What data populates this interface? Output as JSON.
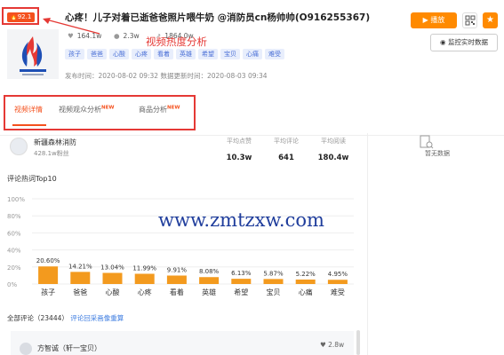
{
  "header": {
    "heat_score": "92.1",
    "title": "心疼！儿子对着已逝爸爸照片喂牛奶 @消防员cn杨帅帅(O916255367)",
    "stats": {
      "likes": "164.1w",
      "comments": "2.3w",
      "shares": "1864.0w"
    },
    "tags": [
      "孩子",
      "爸爸",
      "心酸",
      "心疼",
      "看着",
      "英雄",
      "希望",
      "宝贝",
      "心痛",
      "难受"
    ],
    "publish_label": "发布时间：2020-08-02 09:32",
    "update_label": "数据更新时间：2020-08-03 09:34",
    "play_button": "播放",
    "monitor_button": "监控实时数据",
    "annotation": "视频热度分析"
  },
  "tabs": [
    {
      "label": "视频详情",
      "active": true,
      "new": ""
    },
    {
      "label": "视频观众分析",
      "active": false,
      "new": "NEW"
    },
    {
      "label": "商品分析",
      "active": false,
      "new": "NEW"
    }
  ],
  "profile": {
    "name": "新疆森林消防",
    "fans": "428.1w粉丝",
    "averages": [
      {
        "label": "平均点赞",
        "value": "10.3w"
      },
      {
        "label": "平均评论",
        "value": "641"
      },
      {
        "label": "平均阅读",
        "value": "180.4w"
      }
    ]
  },
  "side": {
    "no_data": "暂无数据"
  },
  "chart_title": "评论热词Top10",
  "chart_data": {
    "type": "bar",
    "categories": [
      "孩子",
      "爸爸",
      "心酸",
      "心疼",
      "看着",
      "英雄",
      "希望",
      "宝贝",
      "心痛",
      "难受"
    ],
    "values": [
      20.6,
      14.21,
      13.04,
      11.99,
      9.91,
      8.08,
      6.13,
      5.87,
      5.22,
      4.95
    ],
    "value_labels": [
      "20.60%",
      "14.21%",
      "13.04%",
      "11.99%",
      "9.91%",
      "8.08%",
      "6.13%",
      "5.87%",
      "5.22%",
      "4.95%"
    ],
    "yticks": [
      "100%",
      "80%",
      "60%",
      "40%",
      "20%",
      "0%"
    ],
    "ylim": [
      0,
      100
    ],
    "color": "#f39a1e",
    "grid": true
  },
  "watermark": "www.zmtzxw.com",
  "comments": {
    "title_label": "全部评论（23444）",
    "link": "评论回采画像重算",
    "first": {
      "user": "方智诚（轩一宝贝）",
      "likes": "2.8w"
    }
  },
  "colors": {
    "accent": "#f4511e",
    "orange": "#ff8a00",
    "annotation": "#e53935"
  }
}
